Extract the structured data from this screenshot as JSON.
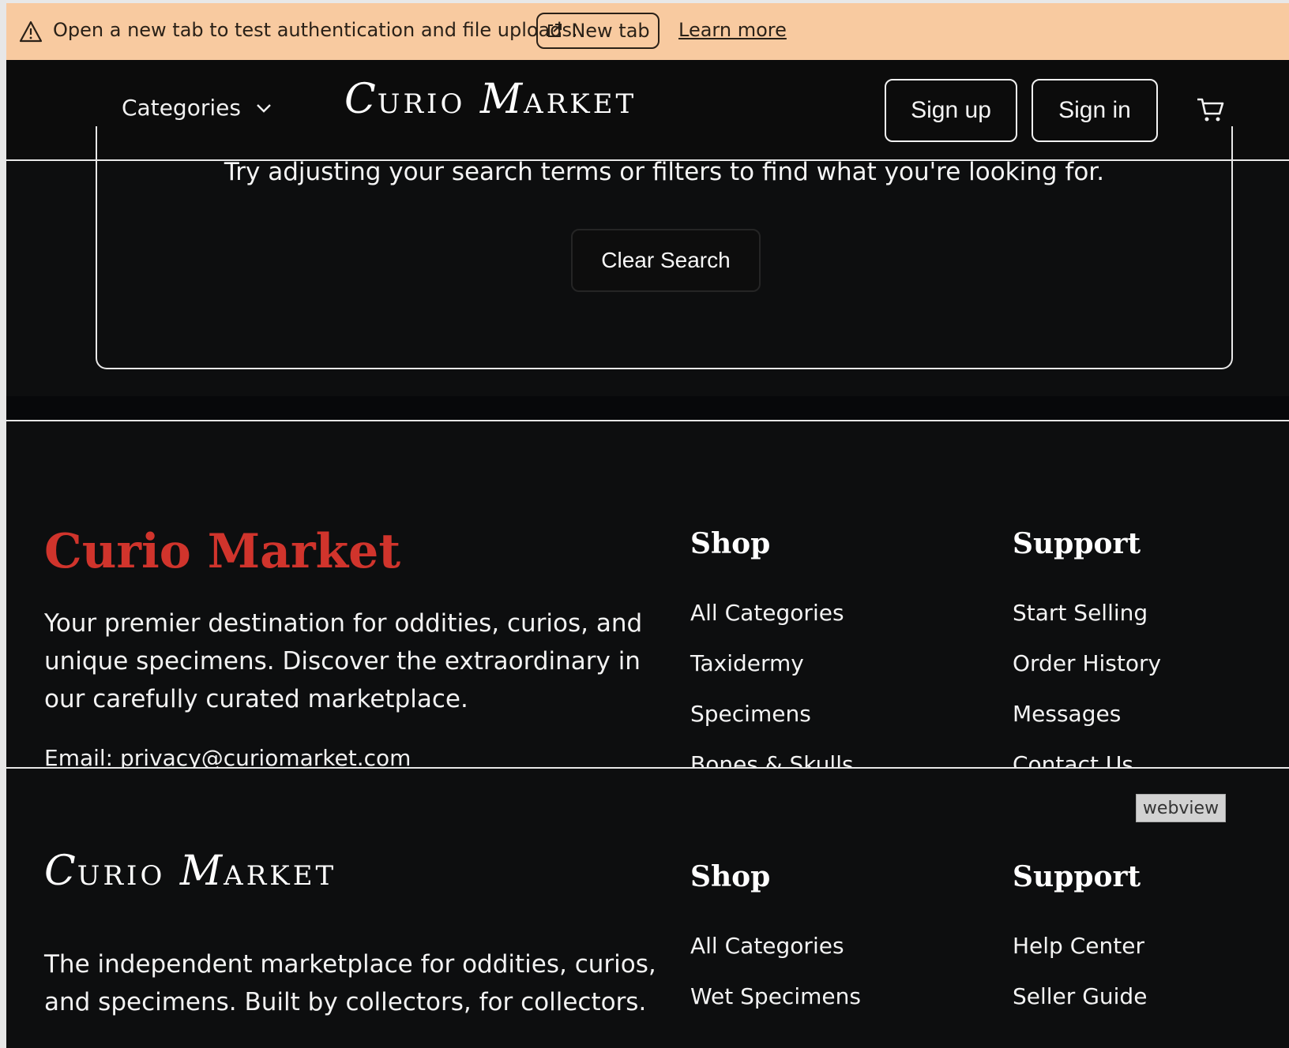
{
  "banner": {
    "message": "Open a new tab to test authentication and file uploads.",
    "new_tab_label": "New tab",
    "learn_more_label": "Learn more"
  },
  "header": {
    "categories_label": "Categories",
    "logo_first": "C",
    "logo_first_small": "URIO",
    "logo_second": "M",
    "logo_second_small": "ARKET",
    "signup_label": "Sign up",
    "signin_label": "Sign in"
  },
  "empty_state": {
    "hint": "Try adjusting your search terms or filters to find what you're looking for.",
    "clear_label": "Clear Search"
  },
  "footer1": {
    "brand": "Curio Market",
    "description": "Your premier destination for oddities, curios, and unique specimens. Discover the extraordinary in our carefully curated marketplace.",
    "email": "Email: privacy@curiomarket.com",
    "shop_heading": "Shop",
    "shop_links": [
      "All Categories",
      "Taxidermy",
      "Specimens",
      "Bones & Skulls"
    ],
    "support_heading": "Support",
    "support_links": [
      "Start Selling",
      "Order History",
      "Messages",
      "Contact Us"
    ]
  },
  "footer2": {
    "webview_badge": "webview",
    "logo_first": "C",
    "logo_first_small": "URIO",
    "logo_second": "M",
    "logo_second_small": "ARKET",
    "description": "The independent marketplace for oddities, curios, and specimens. Built by collectors, for collectors.",
    "shop_heading": "Shop",
    "shop_links": [
      "All Categories",
      "Wet Specimens"
    ],
    "support_heading": "Support",
    "support_links": [
      "Help Center",
      "Seller Guide"
    ]
  }
}
